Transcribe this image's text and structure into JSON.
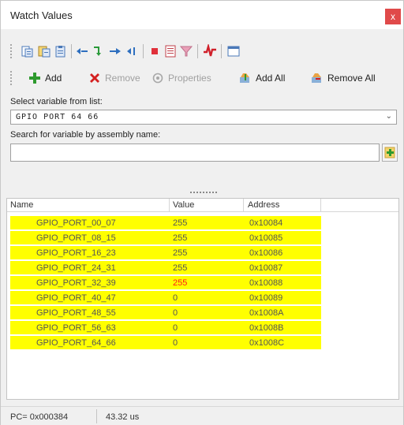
{
  "window": {
    "title": "Watch Values",
    "close_glyph": "x"
  },
  "toolbar2": {
    "add_label": "Add",
    "remove_label": "Remove",
    "properties_label": "Properties",
    "add_all_label": "Add All",
    "remove_all_label": "Remove All"
  },
  "form": {
    "select_label": "Select variable from list:",
    "select_value": "GPIO PORT 64 66",
    "search_label": "Search for variable by assembly name:",
    "search_value": "",
    "search_placeholder": ""
  },
  "grid": {
    "columns": [
      "Name",
      "Value",
      "Address"
    ],
    "rows": [
      {
        "name": "GPIO_PORT_00_07",
        "value": "255",
        "address": "0x10084",
        "changed": false
      },
      {
        "name": "GPIO_PORT_08_15",
        "value": "255",
        "address": "0x10085",
        "changed": false
      },
      {
        "name": "GPIO_PORT_16_23",
        "value": "255",
        "address": "0x10086",
        "changed": false
      },
      {
        "name": "GPIO_PORT_24_31",
        "value": "255",
        "address": "0x10087",
        "changed": false
      },
      {
        "name": "GPIO_PORT_32_39",
        "value": "255",
        "address": "0x10088",
        "changed": true
      },
      {
        "name": "GPIO_PORT_40_47",
        "value": "0",
        "address": "0x10089",
        "changed": false
      },
      {
        "name": "GPIO_PORT_48_55",
        "value": "0",
        "address": "0x1008A",
        "changed": false
      },
      {
        "name": "GPIO_PORT_56_63",
        "value": "0",
        "address": "0x1008B",
        "changed": false
      },
      {
        "name": "GPIO_PORT_64_66",
        "value": "0",
        "address": "0x1008C",
        "changed": false
      }
    ],
    "highlight_color": "#ffff00",
    "changed_color": "#ff1a1a"
  },
  "status": {
    "pc": "PC= 0x000384",
    "time": "43.32 us"
  },
  "icons": {
    "toolbar1": [
      "copy-icon",
      "paste-icon",
      "clipboard-icon",
      "step-back-icon",
      "step-into-icon",
      "step-over-icon",
      "step-out-icon",
      "stop-icon",
      "list-icon",
      "filter-icon",
      "waveform-icon",
      "window-icon"
    ],
    "toolbar2": [
      "add-icon",
      "remove-icon",
      "properties-icon",
      "add-all-icon",
      "remove-all-icon"
    ]
  }
}
